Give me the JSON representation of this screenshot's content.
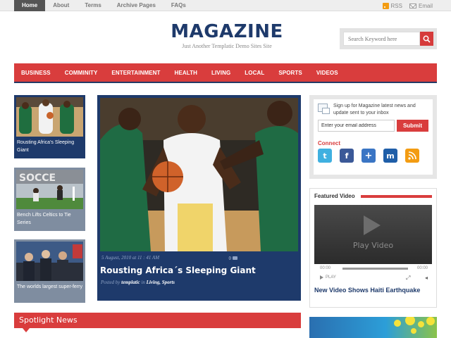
{
  "top_nav": {
    "items": [
      {
        "label": "Home",
        "active": true
      },
      {
        "label": "About"
      },
      {
        "label": "Terms"
      },
      {
        "label": "Archive Pages"
      },
      {
        "label": "FAQs"
      }
    ],
    "rss_label": "RSS",
    "email_label": "Email"
  },
  "header": {
    "title": "MAGAZINE",
    "tagline": "Just Another Templatic Demo Sites Site"
  },
  "search": {
    "placeholder": "Search Keyword here"
  },
  "main_nav": {
    "items": [
      "BUSINESS",
      "COMMINITY",
      "ENTERTAINMENT",
      "HEALTH",
      "LIVING",
      "LOCAL",
      "SPORTS",
      "VIDEOS"
    ]
  },
  "side_posts": [
    {
      "caption": "Rousting Africa's Sleeping Giant"
    },
    {
      "caption": "Bench Lifts Celtics to Tie Series"
    },
    {
      "caption": "The worlds largest super-ferry"
    }
  ],
  "featured": {
    "date": "5 August, 2010 at 11 : 41 AM",
    "comments": "0",
    "title": "Rousting Africa´s Sleeping Giant",
    "posted_by_prefix": "Posted by",
    "author": "templatic",
    "in_label": "in",
    "categories": "Living, Sports"
  },
  "subscribe": {
    "text": "Sign up for Magazine latest news and update sent to your inbox",
    "email_value": "Enter your email address",
    "submit_label": "Submit",
    "connect_label": "Connect",
    "social_icons": [
      "twitter-icon",
      "facebook-icon",
      "delicious-icon",
      "myspace-icon",
      "rss-icon"
    ]
  },
  "video": {
    "heading": "Featured Video",
    "play_label": "Play Video",
    "time_left": "00:00",
    "time_right": "00:00",
    "play_ctrl": "PLAY",
    "title": "New Video Shows Haiti Earthquake"
  },
  "spotlight": {
    "label": "Spotlight News"
  },
  "colors": {
    "brand_red": "#d93d3d",
    "brand_navy": "#1e3a6b",
    "thumb_grey": "#7f8da0"
  }
}
